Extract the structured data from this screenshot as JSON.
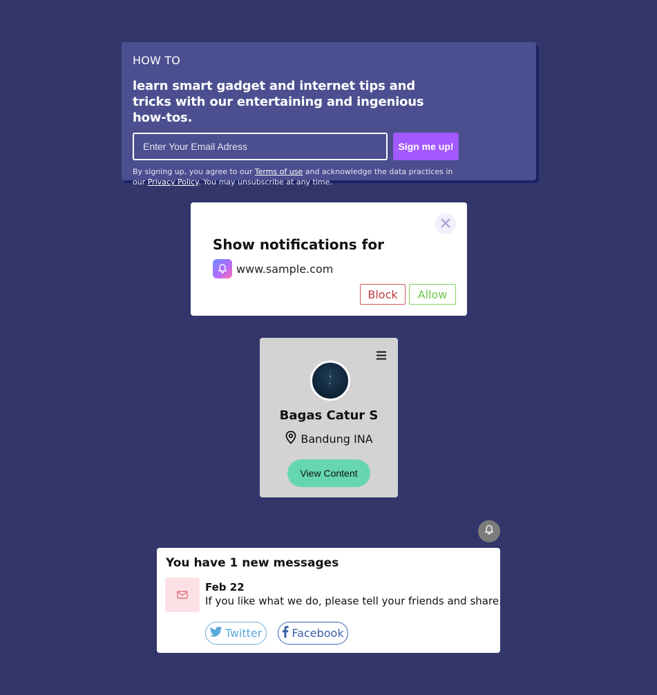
{
  "newsletter": {
    "overline": "HOW TO",
    "headline": "learn smart gadget and internet tips and tricks with our entertaining and ingenious how-tos.",
    "email_placeholder": "Enter Your Email Adress",
    "submit_label": "Sign me up!",
    "legal_prefix": "By signing up, you agree to our ",
    "terms_link": "Terms of use",
    "legal_middle": " and acknowledge the data practices in our ",
    "privacy_link": "Privacy Policy",
    "legal_suffix": ". You may unsubscribe at any time."
  },
  "notification_prompt": {
    "title": "Show notifications for",
    "site": "www.sample.com",
    "block_label": "Block",
    "allow_label": "Allow",
    "close_icon": "close-icon",
    "app_icon": "bell-icon"
  },
  "profile": {
    "name": "Bagas Catur S",
    "location": "Bandung INA",
    "button_label": "View Content",
    "menu_icon": "hamburger-menu-icon",
    "location_icon": "map-pin-icon"
  },
  "messages": {
    "header": "You have 1 new messages",
    "items": [
      {
        "date": "Feb 22",
        "text": "If you like what we do, please tell your friends and share.",
        "icon": "mail-icon"
      }
    ],
    "share": {
      "twitter_label": "Twitter",
      "facebook_label": "Facebook"
    },
    "bell_icon": "bell-icon"
  },
  "colors": {
    "background": "#33366b",
    "newsletter_card": "#4b4f8f",
    "accent_purple": "#a259ff",
    "profile_card": "#d3d3d3",
    "view_content_button": "#65d6b0",
    "block": "#c0393e",
    "allow": "#6cc64a",
    "twitter": "#5aa9dd",
    "facebook": "#3b5fa8"
  }
}
